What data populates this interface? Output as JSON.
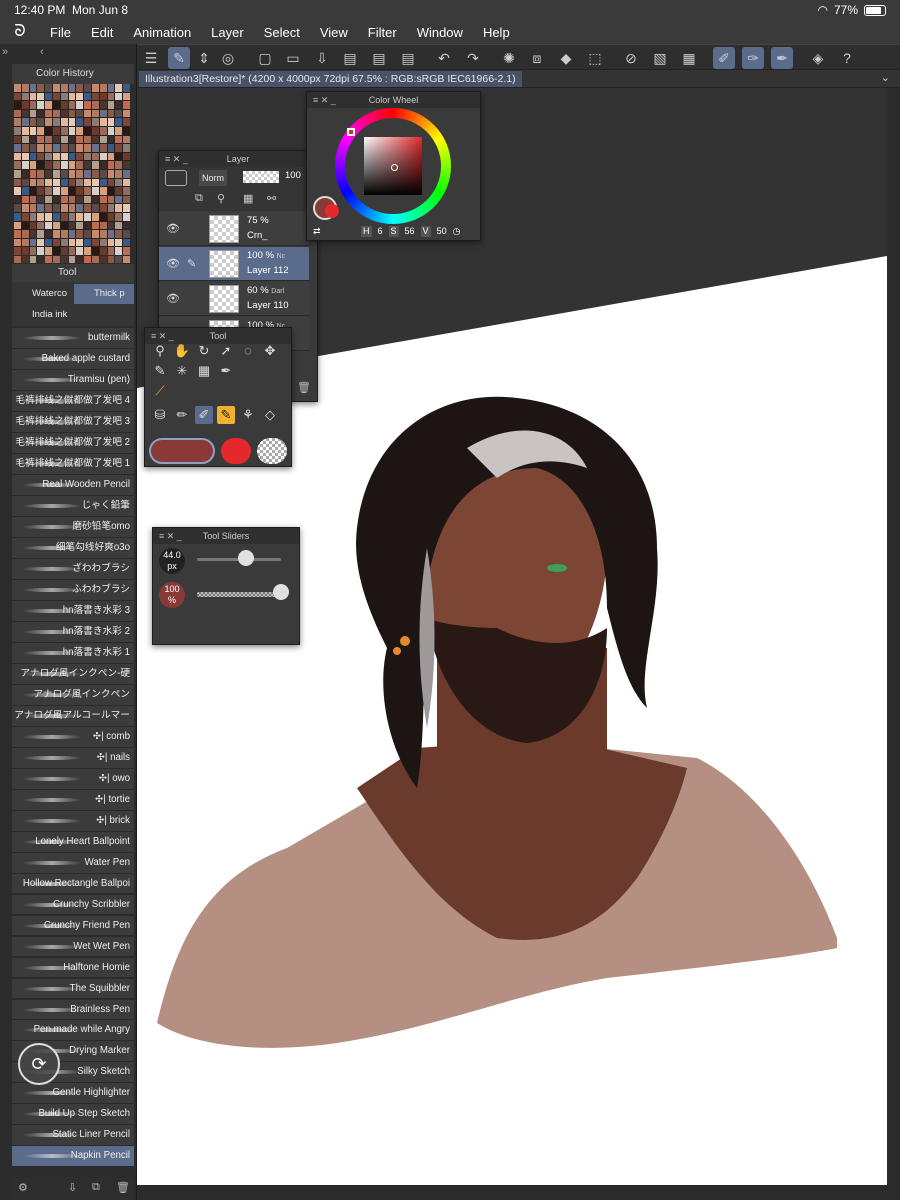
{
  "status": {
    "time": "12:40 PM",
    "date": "Mon Jun 8",
    "battery": "77%"
  },
  "menu": [
    "File",
    "Edit",
    "Animation",
    "Layer",
    "Select",
    "View",
    "Filter",
    "Window",
    "Help"
  ],
  "document": {
    "tab_title": "Illustration3[Restore]* (4200 x 4000px 72dpi 67.5% : RGB:sRGB IEC61966-2.1)"
  },
  "color_history": {
    "title": "Color History"
  },
  "tool_palette": {
    "tab_label": "Tool"
  },
  "subtools": [
    "Waterco",
    "Thick p",
    "India ink"
  ],
  "brushes": [
    "buttermilk",
    "Baked apple custard",
    "Tiramisu (pen)",
    "毛裤排线之僦都做了发吧 4",
    "毛裤排线之僦都做了发吧 3",
    "毛裤排线之僦都做了发吧 2",
    "毛裤排线之僦都做了发吧 1",
    "Real Wooden Pencil",
    "じゃく鉛筆",
    "磨砂铅笔omo",
    "细笔勾线好爽o3o",
    "ざわわブラシ",
    "ふわわブラシ",
    "hn落書き水彩 3",
    "hn落書き水彩 2",
    "hn落書き水彩 1",
    "アナログ風インクペン-硬",
    "アナログ風インクペン",
    "アナログ風アルコールマー",
    "✣| comb",
    "✣| nails",
    "✣| owo",
    "✣| tortie",
    "✣| brick",
    "Lonely Heart Ballpoint",
    "Water Pen",
    "Hollow Rectangle Ballpoi",
    "Crunchy Scribbler",
    "Crunchy Friend Pen",
    "Wet Wet Pen",
    "Halftone Homie",
    "The Squibbler",
    "Brainless Pen",
    "Pen made while Angry",
    "Drying Marker",
    "Silky Sketch",
    "Gentle Highlighter",
    "Build Up Step Sketch",
    "Static Liner Pencil",
    "Napkin Pencil"
  ],
  "layer_panel": {
    "title": "Layer",
    "blend_mode": "Norm",
    "opacity": "100",
    "layers": [
      {
        "percent": "75 %",
        "name": "Crn_"
      },
      {
        "percent": "100 %",
        "mode": "Nc",
        "name": "Layer 112"
      },
      {
        "percent": "60 %",
        "mode": "Darl",
        "name": "Layer 110"
      },
      {
        "percent": "100 %",
        "mode": "Nc",
        "name": ""
      }
    ]
  },
  "color_wheel": {
    "title": "Color Wheel",
    "h_label": "H",
    "h": "6",
    "s_label": "S",
    "s": "56",
    "v_label": "V",
    "v": "50"
  },
  "tool_panel": {
    "title": "Tool"
  },
  "tool_sliders": {
    "title": "Tool Sliders",
    "size_value": "44.0",
    "size_unit": "px",
    "size_level": 0.58,
    "opacity_value": "100",
    "opacity_unit": "%",
    "opacity_level": 1.0
  },
  "colors": {
    "main": "#8a3a36",
    "sub": "#e4282b",
    "accent": "#5a6b8c",
    "selected_tool": "#f2b12c"
  }
}
